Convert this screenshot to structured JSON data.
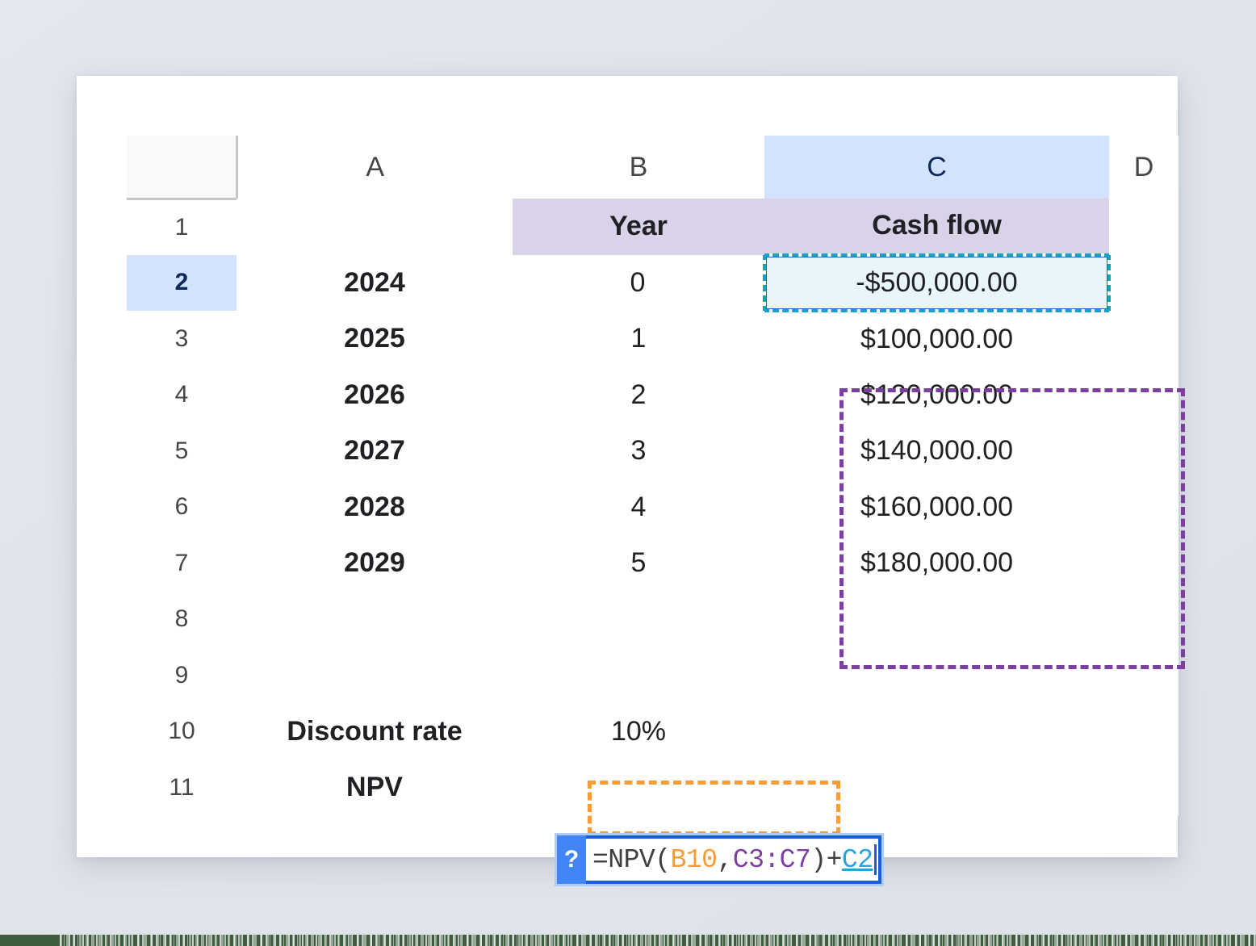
{
  "spreadsheet": {
    "column_headers": [
      "",
      "A",
      "B",
      "C",
      "D"
    ],
    "selected_column": "C",
    "selected_row": "2",
    "row_numbers": [
      "1",
      "2",
      "3",
      "4",
      "5",
      "6",
      "7",
      "8",
      "9",
      "10",
      "11"
    ],
    "rows": [
      {
        "num": "1",
        "a": "",
        "b": "Year",
        "c": "Cash flow",
        "d": ""
      },
      {
        "num": "2",
        "a": "2024",
        "b": "0",
        "c": "-$500,000.00",
        "d": ""
      },
      {
        "num": "3",
        "a": "2025",
        "b": "1",
        "c": "$100,000.00",
        "d": ""
      },
      {
        "num": "4",
        "a": "2026",
        "b": "2",
        "c": "$120,000.00",
        "d": ""
      },
      {
        "num": "5",
        "a": "2027",
        "b": "3",
        "c": "$140,000.00",
        "d": ""
      },
      {
        "num": "6",
        "a": "2028",
        "b": "4",
        "c": "$160,000.00",
        "d": ""
      },
      {
        "num": "7",
        "a": "2029",
        "b": "5",
        "c": "$180,000.00",
        "d": ""
      },
      {
        "num": "8",
        "a": "",
        "b": "",
        "c": "",
        "d": ""
      },
      {
        "num": "9",
        "a": "",
        "b": "",
        "c": "",
        "d": ""
      },
      {
        "num": "10",
        "a": "Discount rate",
        "b": "10%",
        "c": "",
        "d": ""
      },
      {
        "num": "11",
        "a": "NPV",
        "b": "",
        "c": "",
        "d": ""
      }
    ]
  },
  "formula_editor": {
    "help_badge": "?",
    "cell": "C11",
    "tokens": [
      {
        "text": "=NPV(",
        "color_role": "plain"
      },
      {
        "text": "B10",
        "color_role": "orange"
      },
      {
        "text": ",",
        "color_role": "plain"
      },
      {
        "text": "C3:C7",
        "color_role": "purple"
      },
      {
        "text": ")+",
        "color_role": "plain"
      },
      {
        "text": "C2",
        "color_role": "blue"
      }
    ],
    "full_text": "=NPV(B10,C3:C7)+C2"
  },
  "reference_highlights": [
    {
      "name": "C2",
      "range": "C2",
      "color": "#18a0c8",
      "style": "dashed"
    },
    {
      "name": "C3C7",
      "range": "C3:C7",
      "color": "#7b3fa0",
      "style": "dashed"
    },
    {
      "name": "B10",
      "range": "B10",
      "color": "#f79c36",
      "style": "dashed"
    }
  ],
  "colors": {
    "page_background": "#e3e6ed",
    "card": "#ffffff",
    "header_selected": "#d3e3fd",
    "row1_fill": "#d9d2e9",
    "c2_fill": "#e8f5fa",
    "cyan_ref": "#18a0c8",
    "purple_ref": "#7b3fa0",
    "orange_ref": "#f79c36",
    "editor_border": "#1a5fd0",
    "editor_halo": "#aecbfa",
    "help_badge": "#4285f4",
    "grid_line": "#e0e0e0",
    "header_line": "#c4c7c5",
    "bottom_strip": "#3f5c3f"
  }
}
